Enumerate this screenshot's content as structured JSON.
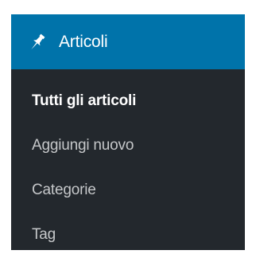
{
  "menu": {
    "header": {
      "icon": "pushpin-icon",
      "title": "Articoli"
    },
    "items": [
      {
        "label": "Tutti gli articoli",
        "current": true
      },
      {
        "label": "Aggiungi nuovo",
        "current": false
      },
      {
        "label": "Categorie",
        "current": false
      },
      {
        "label": "Tag",
        "current": false
      }
    ]
  },
  "colors": {
    "header_background": "#0073aa",
    "menu_background": "#23282d",
    "current_text": "#ffffff",
    "item_text": "#c5c7c9"
  }
}
